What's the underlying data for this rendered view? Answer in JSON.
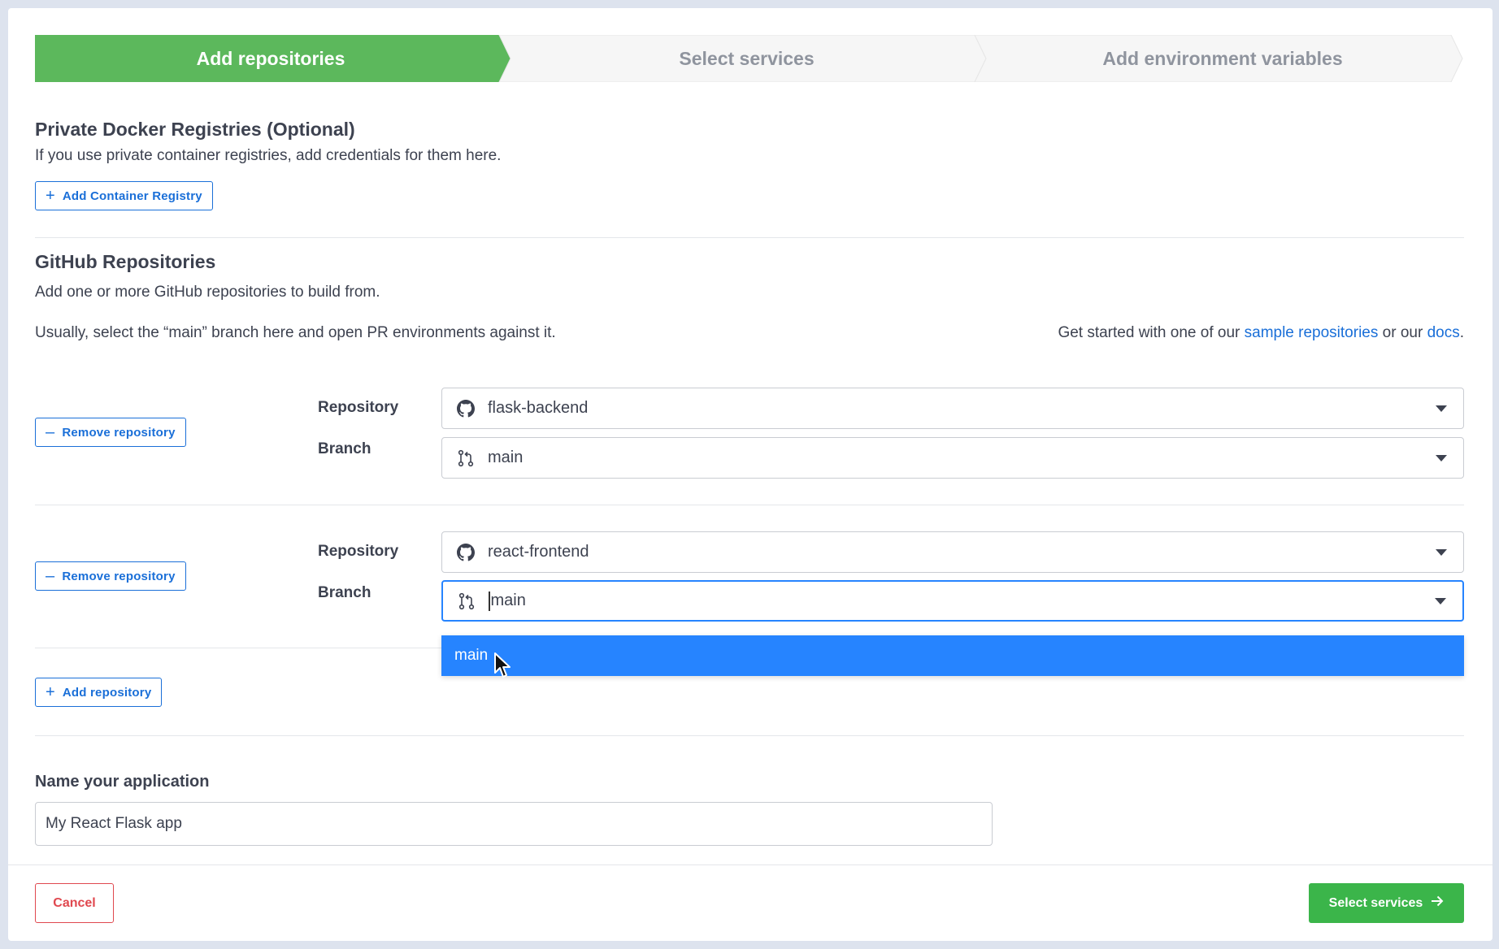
{
  "stepper": {
    "steps": [
      {
        "label": "Add repositories",
        "state": "active"
      },
      {
        "label": "Select services",
        "state": "inactive"
      },
      {
        "label": "Add environment variables",
        "state": "inactive"
      }
    ],
    "active_color": "#5cb85c"
  },
  "registries": {
    "title": "Private Docker Registries (Optional)",
    "description": "If you use private container registries, add credentials for them here.",
    "add_button": "Add Container Registry"
  },
  "github": {
    "title": "GitHub Repositories",
    "description": "Add one or more GitHub repositories to build from.",
    "hint": "Usually, select the “main” branch here and open PR environments against it.",
    "help_prefix": "Get started with one of our ",
    "help_link_samples": "sample repositories",
    "help_middle": " or our ",
    "help_link_docs": "docs",
    "help_suffix": ".",
    "repositories": [
      {
        "remove_label": "Remove repository",
        "repository_label": "Repository",
        "repository_value": "flask-backend",
        "branch_label": "Branch",
        "branch_value": "main"
      },
      {
        "remove_label": "Remove repository",
        "repository_label": "Repository",
        "repository_value": "react-frontend",
        "branch_label": "Branch",
        "branch_value": "main"
      }
    ],
    "branch_dropdown_option": "main",
    "add_repository": "Add repository"
  },
  "app_name": {
    "label": "Name your application",
    "value": "My React Flask app"
  },
  "footer": {
    "cancel": "Cancel",
    "next": "Select services"
  },
  "colors": {
    "primary_green": "#3bb54a",
    "link_blue": "#1a6fd8",
    "focus_blue": "#2684ff",
    "danger_red": "#e0484f"
  }
}
